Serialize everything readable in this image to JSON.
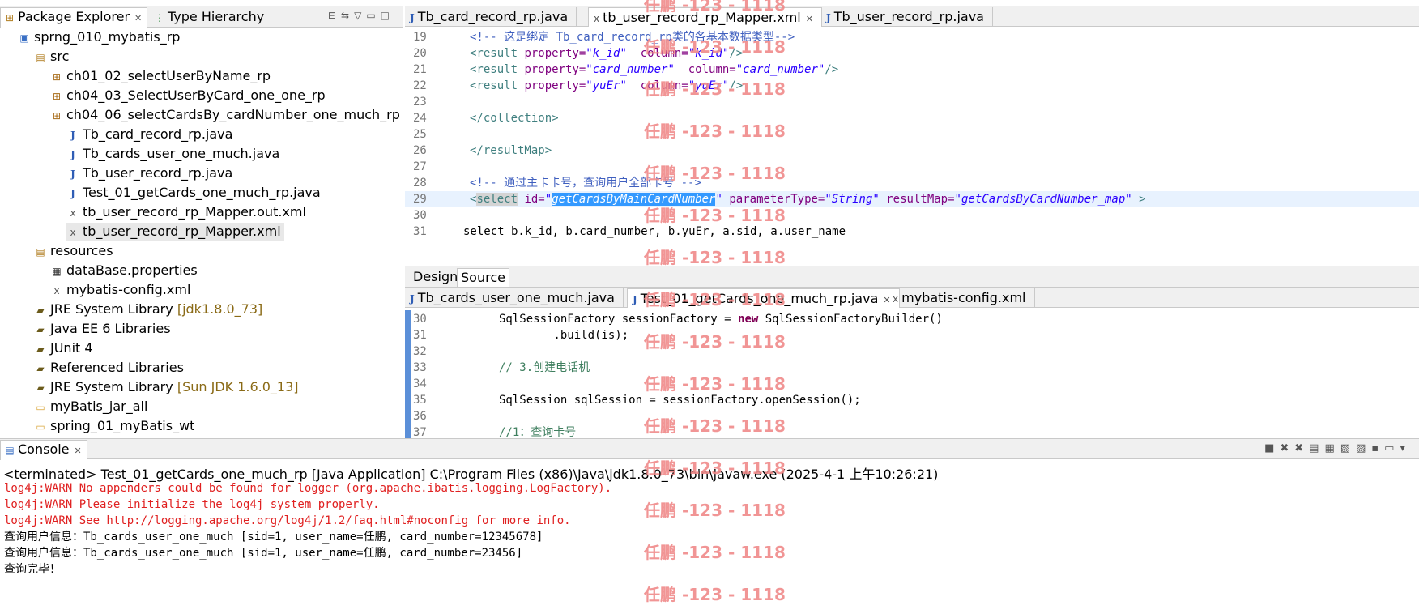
{
  "package_explorer": {
    "tabs": [
      {
        "label": "Package Explorer",
        "icon": "package-explorer-icon"
      },
      {
        "label": "Type Hierarchy",
        "icon": "hierarchy-icon"
      }
    ],
    "tree": [
      {
        "label": "sprng_010_mybatis_rp",
        "icon": "project-icon"
      },
      {
        "label": "src",
        "icon": "source-folder-icon"
      },
      {
        "label": "ch01_02_selectUserByName_rp",
        "icon": "package-icon"
      },
      {
        "label": "ch04_03_SelectUserByCard_one_one_rp",
        "icon": "package-icon"
      },
      {
        "label": "ch04_06_selectCardsBy_cardNumber_one_much_rp",
        "icon": "package-icon"
      },
      {
        "label": "Tb_card_record_rp.java",
        "icon": "java-file-icon"
      },
      {
        "label": "Tb_cards_user_one_much.java",
        "icon": "java-file-icon"
      },
      {
        "label": "Tb_user_record_rp.java",
        "icon": "java-file-icon"
      },
      {
        "label": "Test_01_getCards_one_much_rp.java",
        "icon": "java-file-icon"
      },
      {
        "label": "tb_user_record_rp_Mapper.out.xml",
        "icon": "xml-file-icon"
      },
      {
        "label": "tb_user_record_rp_Mapper.xml",
        "icon": "xml-file-icon"
      },
      {
        "label": "resources",
        "icon": "source-folder-icon"
      },
      {
        "label": "dataBase.properties",
        "icon": "properties-file-icon"
      },
      {
        "label": "mybatis-config.xml",
        "icon": "xml-file-icon"
      },
      {
        "label": "JRE System Library",
        "suffix": "[jdk1.8.0_73]",
        "icon": "library-icon"
      },
      {
        "label": "Java EE 6 Libraries",
        "icon": "library-icon"
      },
      {
        "label": "JUnit 4",
        "icon": "library-icon"
      },
      {
        "label": "Referenced Libraries",
        "icon": "library-icon"
      },
      {
        "label": "JRE System Library",
        "suffix": "[Sun JDK 1.6.0_13]",
        "icon": "library-icon"
      },
      {
        "label": "myBatis_jar_all",
        "icon": "folder-icon"
      },
      {
        "label": "spring_01_myBatis_wt",
        "icon": "project-folder-icon"
      }
    ]
  },
  "editor_top": {
    "tabs": [
      "Tb_card_record_rp.java",
      "tb_user_record_rp_Mapper.xml",
      "Tb_user_record_rp.java"
    ],
    "lines": [
      {
        "n": "19",
        "text": "<!-- 这是绑定 Tb_card_record_rp类的各基本数据类型-->"
      },
      {
        "n": "20",
        "text": "<result property=\"k_id\"  column=\"k_id\"/>"
      },
      {
        "n": "21",
        "text": "<result property=\"card_number\"  column=\"card_number\"/>"
      },
      {
        "n": "22",
        "text": "<result property=\"yuEr\"  column=\"yuEr\"/>"
      },
      {
        "n": "23",
        "text": ""
      },
      {
        "n": "24",
        "text": "</collection>"
      },
      {
        "n": "25",
        "text": ""
      },
      {
        "n": "26",
        "text": "</resultMap>"
      },
      {
        "n": "27",
        "text": ""
      },
      {
        "n": "28",
        "text": "<!-- 通过主卡卡号，查询用户全部卡号 -->"
      },
      {
        "n": "29",
        "text": "<select id=\"getCardsByMainCardNumber\" parameterType=\"String\" resultMap=\"getCardsByCardNumber_map\" >"
      },
      {
        "n": "30",
        "text": ""
      },
      {
        "n": "31",
        "text": "select b.k_id, b.card_number, b.yuEr, a.sid, a.user_name"
      }
    ],
    "bottom_tabs": [
      "Design",
      "Source"
    ]
  },
  "editor_bottom": {
    "tabs": [
      "Tb_cards_user_one_much.java",
      "Test_01_getCards_one_much_rp.java",
      "mybatis-config.xml"
    ],
    "lines": [
      {
        "n": "30",
        "text": "SqlSessionFactory sessionFactory = new SqlSessionFactoryBuilder()"
      },
      {
        "n": "31",
        "text": "        .build(is);"
      },
      {
        "n": "32",
        "text": ""
      },
      {
        "n": "33",
        "text": "// 3.创建电话机"
      },
      {
        "n": "34",
        "text": ""
      },
      {
        "n": "35",
        "text": "SqlSession sqlSession = sessionFactory.openSession();"
      },
      {
        "n": "36",
        "text": ""
      },
      {
        "n": "37",
        "text": "//1：查询卡号"
      }
    ]
  },
  "console": {
    "tab_label": "Console",
    "status": "<terminated> Test_01_getCards_one_much_rp [Java Application] C:\\Program Files (x86)\\Java\\jdk1.8.0_73\\bin\\javaw.exe (2025-4-1 上午10:26:21)",
    "lines": [
      {
        "text": "log4j:WARN No appenders could be found for logger (org.apache.ibatis.logging.LogFactory).",
        "type": "warn"
      },
      {
        "text": "log4j:WARN Please initialize the log4j system properly.",
        "type": "warn"
      },
      {
        "text": "log4j:WARN See http://logging.apache.org/log4j/1.2/faq.html#noconfig for more info.",
        "type": "warn"
      },
      {
        "text": "查询用户信息：Tb_cards_user_one_much [sid=1, user_name=任鹏, card_number=12345678]",
        "type": "out"
      },
      {
        "text": "查询用户信息：Tb_cards_user_one_much [sid=1, user_name=任鹏, card_number=23456]",
        "type": "out"
      },
      {
        "text": "查询完毕！",
        "type": "out"
      }
    ]
  },
  "watermark": "任鹏 -123 - 1118",
  "colors": {
    "warn": "#e02020",
    "selection": "#3399ff",
    "watermark": "#f08a8a"
  }
}
